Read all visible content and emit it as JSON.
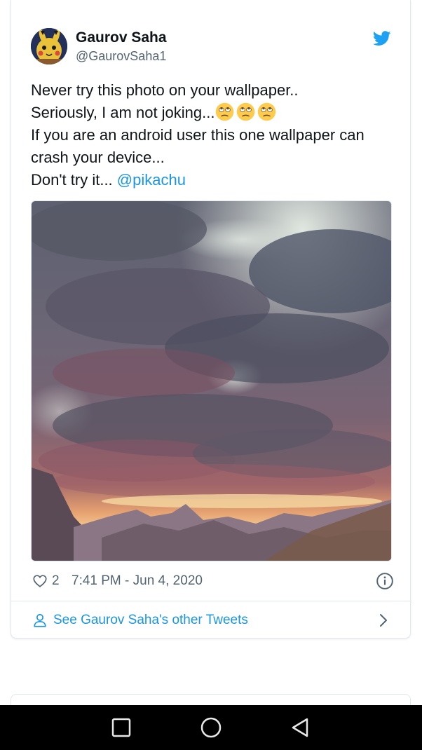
{
  "tweet": {
    "author_name": "Gaurov Saha",
    "author_handle": "@GaurovSaha1",
    "text_lines": [
      "Never try this photo on your wallpaper..",
      "Seriously, I am not joking...",
      "If you are an android user this one wallpaper can",
      "crash your device...",
      "Don't try it... "
    ],
    "mention": "@pikachu",
    "emojis": [
      "face-with-rolling-eyes-icon",
      "face-with-rolling-eyes-icon",
      "face-with-rolling-eyes-icon"
    ],
    "like_count": "2",
    "timestamp": "7:41 PM - Jun 4, 2020"
  },
  "footer": {
    "other_tweets_label": "See Gaurov Saha's other Tweets"
  },
  "icons": {
    "brand": "twitter-bird-icon",
    "like": "heart-icon",
    "info": "info-icon",
    "profile": "person-icon",
    "more": "chevron-right-icon",
    "nav_recents": "square-icon",
    "nav_home": "circle-icon",
    "nav_back": "triangle-back-icon"
  },
  "colors": {
    "link": "#1b95e0",
    "text": "#0f1419",
    "muted": "#536471",
    "twitter_blue": "#1da1f2",
    "nav_bar": "#000000"
  }
}
